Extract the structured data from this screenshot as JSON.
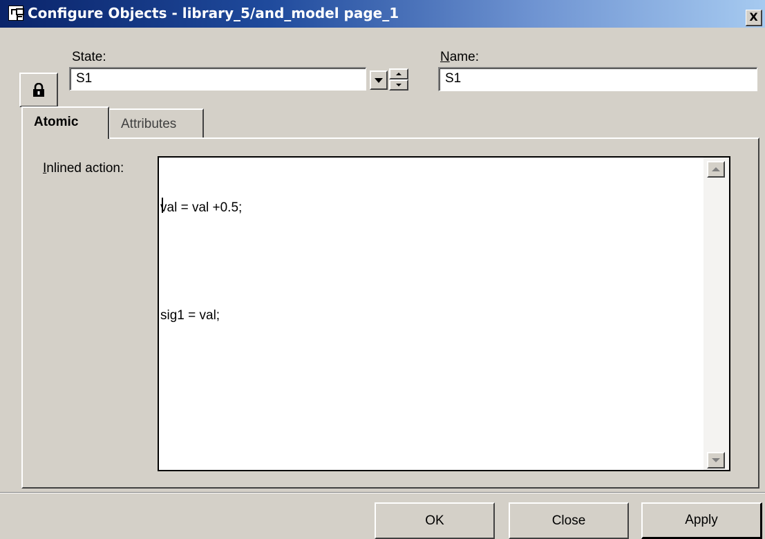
{
  "window": {
    "title": "Configure Objects - library_5/and_model page_1",
    "close_glyph": "X"
  },
  "header": {
    "state_label": "State:",
    "state_value": "S1",
    "name_label": "Name:",
    "name_value": "S1"
  },
  "tabs": [
    {
      "label": "Atomic",
      "active": true
    },
    {
      "label": "Attributes",
      "active": false
    }
  ],
  "atomic": {
    "inlined_action_label": "Inlined action:",
    "code_lines": [
      "val = val +0.5;",
      "",
      "sig1 = val;"
    ]
  },
  "buttons": {
    "ok": "OK",
    "close": "Close",
    "apply": "Apply"
  },
  "icons": {
    "app": "configure-objects-app-icon",
    "lock": "lock-icon"
  }
}
